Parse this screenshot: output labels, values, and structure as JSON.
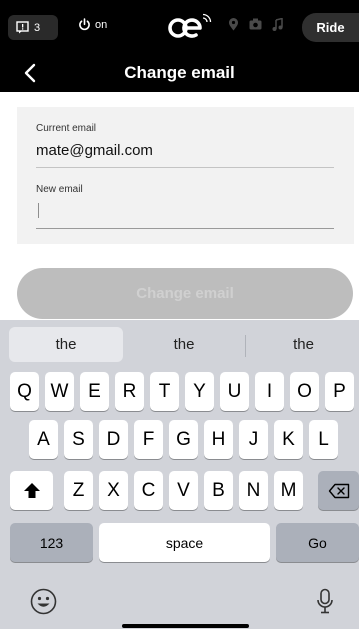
{
  "status_bar": {
    "notification_count": "3",
    "power_status": "on",
    "ride_button": "Ride"
  },
  "header": {
    "title": "Change email"
  },
  "form": {
    "current_email_label": "Current email",
    "current_email_value": "mate@gmail.com",
    "new_email_label": "New email",
    "new_email_value": "",
    "submit_label": "Change email"
  },
  "keyboard": {
    "suggestions": [
      "the",
      "the",
      "the"
    ],
    "row1": [
      "Q",
      "W",
      "E",
      "R",
      "T",
      "Y",
      "U",
      "I",
      "O",
      "P"
    ],
    "row2": [
      "A",
      "S",
      "D",
      "F",
      "G",
      "H",
      "J",
      "K",
      "L"
    ],
    "row3": [
      "Z",
      "X",
      "C",
      "V",
      "B",
      "N",
      "M"
    ],
    "numbers_key": "123",
    "space_key": "space",
    "go_key": "Go"
  },
  "colors": {
    "bar_background": "#000000",
    "card_background": "#f2f2f2",
    "button_disabled": "#bdbdbd",
    "keyboard_background": "#d1d3d9"
  },
  "icons": [
    "notification-icon",
    "power-icon",
    "brand-logo",
    "location-icon",
    "camera-icon",
    "music-icon",
    "back-arrow-icon",
    "shift-icon",
    "backspace-icon",
    "emoji-icon",
    "microphone-icon"
  ]
}
